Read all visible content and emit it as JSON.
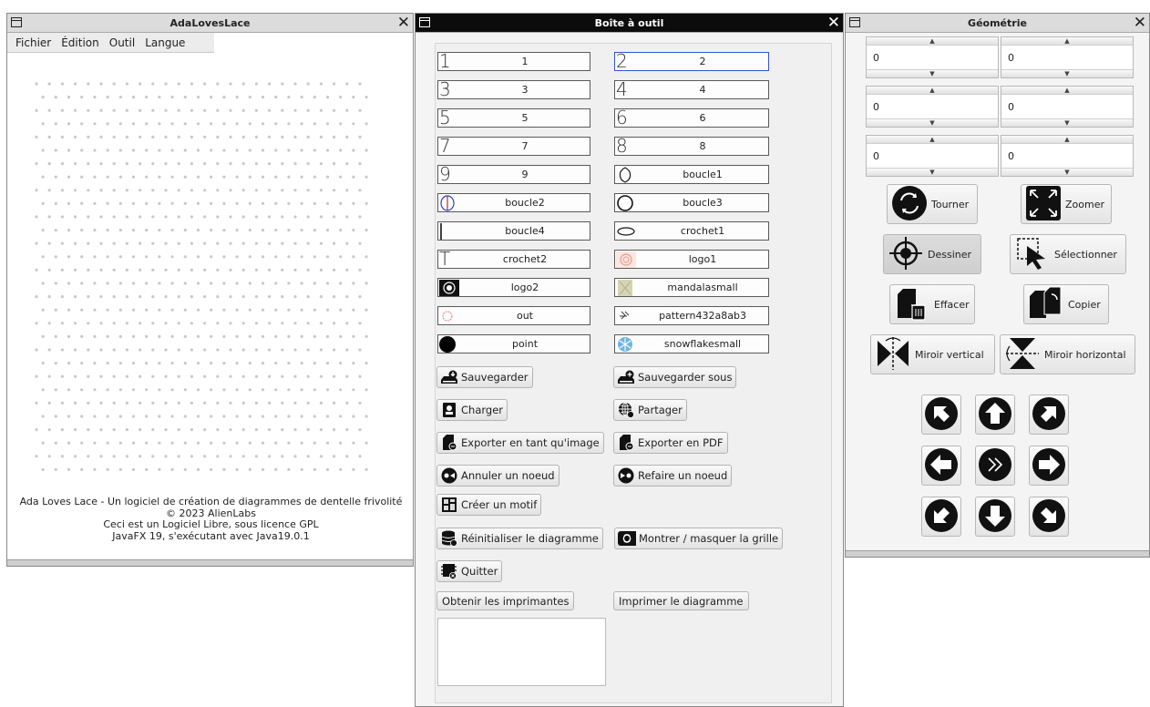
{
  "w1": {
    "title": "AdaLovesLace",
    "menu": [
      "Fichier",
      "Édition",
      "Outil",
      "Langue"
    ],
    "footer": [
      "Ada Loves Lace - Un logiciel de création de diagrammes de dentelle frivolité",
      "© 2023 AlienLabs",
      "Ceci est un Logiciel Libre, sous licence GPL",
      "JavaFX 19, s'exécutant avec Java19.0.1"
    ]
  },
  "w2": {
    "title": "Boîte à outil",
    "shapes": [
      {
        "icon": "1",
        "label": "1"
      },
      {
        "icon": "2",
        "label": "2"
      },
      {
        "icon": "3",
        "label": "3"
      },
      {
        "icon": "4",
        "label": "4"
      },
      {
        "icon": "5",
        "label": "5"
      },
      {
        "icon": "6",
        "label": "6"
      },
      {
        "icon": "7",
        "label": "7"
      },
      {
        "icon": "8",
        "label": "8"
      },
      {
        "icon": "9",
        "label": "9"
      },
      {
        "icon": "boucle1-icon",
        "label": "boucle1"
      },
      {
        "icon": "boucle2-icon",
        "label": "boucle2"
      },
      {
        "icon": "boucle3-icon",
        "label": "boucle3"
      },
      {
        "icon": "boucle4-icon",
        "label": "boucle4"
      },
      {
        "icon": "crochet1-icon",
        "label": "crochet1"
      },
      {
        "icon": "T",
        "label": "crochet2"
      },
      {
        "icon": "logo1-icon",
        "label": "logo1"
      },
      {
        "icon": "logo2-icon",
        "label": "logo2"
      },
      {
        "icon": "mandala-icon",
        "label": "mandalasmall"
      },
      {
        "icon": "out-icon",
        "label": "out"
      },
      {
        "icon": "pattern-icon",
        "label": "pattern432a8ab3"
      },
      {
        "icon": "point-icon",
        "label": "point"
      },
      {
        "icon": "snowflake-icon",
        "label": "snowflakesmall"
      }
    ],
    "actions": {
      "save": "Sauvegarder",
      "save_as": "Sauvegarder sous",
      "load": "Charger",
      "share": "Partager",
      "export_image": "Exporter en tant qu'image",
      "export_pdf": "Exporter en PDF",
      "undo": "Annuler un noeud",
      "redo": "Refaire un noeud",
      "create_pattern": "Créer un motif",
      "reset": "Réinitialiser le diagramme",
      "toggle_grid": "Montrer / masquer la grille",
      "quit": "Quitter",
      "get_printers": "Obtenir les imprimantes",
      "print": "Imprimer le diagramme"
    }
  },
  "w3": {
    "title": "Géométrie",
    "spinners": [
      "0",
      "0",
      "0",
      "0",
      "0",
      "0"
    ],
    "tools": {
      "rotate": "Tourner",
      "zoom": "Zoomer",
      "draw": "Dessiner",
      "select": "Sélectionner",
      "erase": "Effacer",
      "copy": "Copier",
      "mirror_v": "Miroir vertical",
      "mirror_h": "Miroir horizontal"
    }
  }
}
